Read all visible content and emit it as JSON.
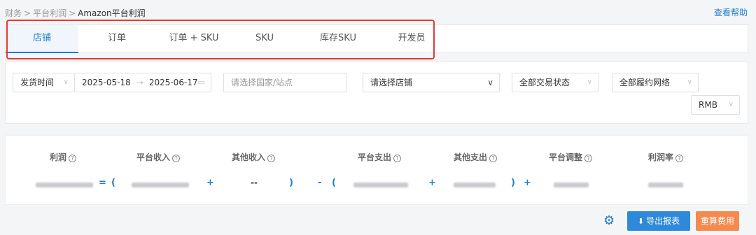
{
  "breadcrumb": {
    "items": [
      "财务",
      "平台利润"
    ],
    "current": "Amazon平台利润",
    "sep": ">"
  },
  "help": {
    "label": "查看帮助"
  },
  "tabs": [
    {
      "label": "店铺"
    },
    {
      "label": "订单"
    },
    {
      "label": "订单 + SKU"
    },
    {
      "label": "SKU"
    },
    {
      "label": "库存SKU"
    },
    {
      "label": "开发员"
    }
  ],
  "filters": {
    "date_type": "发货时间",
    "date_start": "2025-05-18",
    "date_arrow": "→",
    "date_end": "2025-06-17",
    "country_placeholder": "请选择国家/站点",
    "shop_placeholder": "请选择店铺",
    "trade_status": "全部交易状态",
    "fulfillment": "全部履约网络",
    "currency": "RMB"
  },
  "metrics": {
    "profit": "利润",
    "platform_income": "平台收入",
    "other_income": "其他收入",
    "platform_expense": "平台支出",
    "other_expense": "其他支出",
    "platform_adjust": "平台调整",
    "profit_rate": "利润率",
    "other_income_value": "--"
  },
  "formula": {
    "eq": "=",
    "open": "(",
    "plus": "+",
    "close": ")",
    "minus": "-"
  },
  "actions": {
    "export": "导出报表",
    "recalc": "重算费用"
  },
  "icons": {
    "help": "?",
    "settings": "⚙",
    "download": "⬇",
    "chevron": "∨",
    "calendar": "▭"
  }
}
